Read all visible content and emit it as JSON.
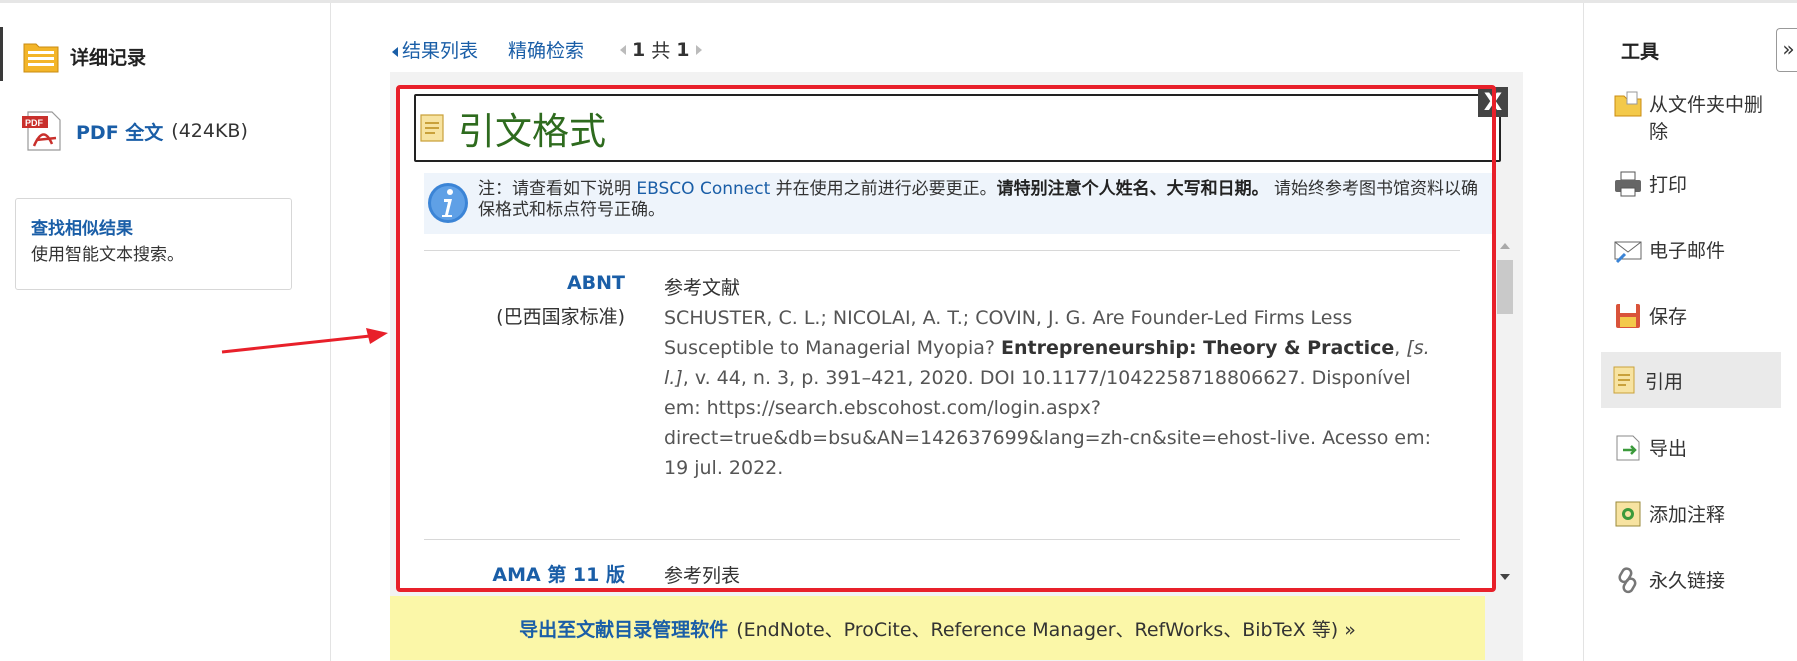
{
  "left": {
    "detail_label": "详细记录",
    "pdf_label": "PDF 全文",
    "pdf_size": "(424KB)",
    "similar_title": "查找相似结果",
    "similar_sub": "使用智能文本搜索。"
  },
  "nav": {
    "results_list": "结果列表",
    "refine": "精确检索",
    "page_current": "1",
    "page_of": "共",
    "page_total": "1"
  },
  "cite": {
    "title": "引文格式",
    "close": "X",
    "note_prefix": "注：请查看如下说明 ",
    "note_link": "EBSCO Connect",
    "note_mid": " 并在使用之前进行必要更正。",
    "note_bold": "请特别注意个人姓名、大写和日期。",
    "note_suffix": " 请始终参考图书馆资料以确保格式和标点符号正确。",
    "styles": [
      {
        "name": "ABNT",
        "sub": "(巴西国家标准)",
        "head": "参考文献",
        "body_1": "SCHUSTER, C. L.; NICOLAI, A. T.; COVIN, J. G. Are Founder-Led Firms Less Susceptible to Managerial Myopia? ",
        "body_journal": "Entrepreneurship: Theory & Practice",
        "body_2": ", ",
        "body_italic": "[s. l.]",
        "body_3": ", v. 44, n. 3, p. 391–421, 2020. DOI 10.1177/1042258718806627. Disponível em: https://search.ebscohost.com/login.aspx?direct=true&db=bsu&AN=142637699&lang=zh-cn&site=ehost-live. Acesso em: 19 jul. 2022."
      },
      {
        "name": "AMA 第 11 版",
        "head": "参考列表"
      }
    ]
  },
  "export": {
    "link": "导出至文献目录管理软件",
    "rest": "(EndNote、ProCite、Reference Manager、RefWorks、BibTeX 等)  »"
  },
  "tools": {
    "title": "工具",
    "collapse": "»",
    "items": [
      {
        "label": "从文件夹中删除",
        "icon": "folder-remove-icon"
      },
      {
        "label": "打印",
        "icon": "printer-icon"
      },
      {
        "label": "电子邮件",
        "icon": "email-icon"
      },
      {
        "label": "保存",
        "icon": "save-icon"
      },
      {
        "label": "引用",
        "icon": "cite-icon"
      },
      {
        "label": "导出",
        "icon": "export-icon"
      },
      {
        "label": "添加注释",
        "icon": "add-note-icon"
      },
      {
        "label": "永久链接",
        "icon": "permalink-icon"
      }
    ]
  },
  "colors": {
    "link": "#1a5ea7",
    "highlight_frame": "#e8202a",
    "title_green": "#2e6b1e",
    "export_bar": "#fbf7a8"
  }
}
